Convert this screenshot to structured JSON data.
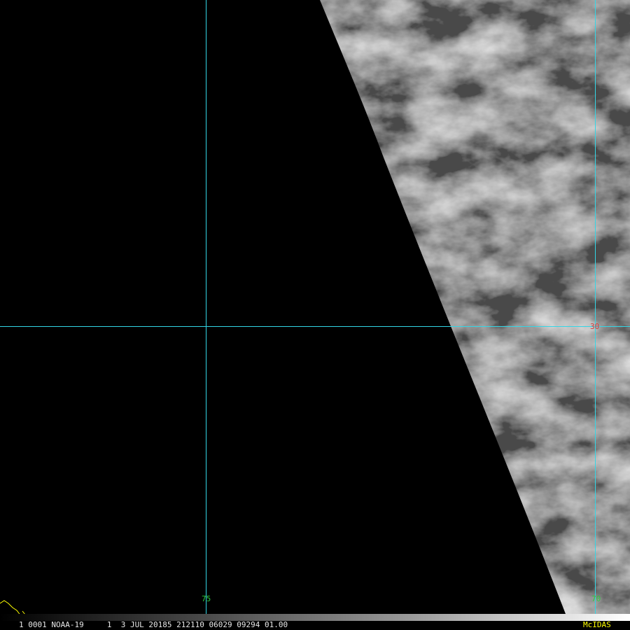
{
  "image": {
    "grid_color": "#33d6e6",
    "lon_label_color": "#2ecc40",
    "lat_label_color": "#d03a3a",
    "info_text_color": "#e8e8e8",
    "brand_color": "#ffff00",
    "coast_color": "#ffff00",
    "background": "#000000"
  },
  "grid": {
    "lon_labels": [
      "75",
      "70"
    ],
    "lat_labels": [
      "30"
    ]
  },
  "footer": {
    "info": "1 0001 NOAA-19     1  3 JUL 20185 212110 06029 09294 01.00",
    "brand": "McIDAS"
  }
}
